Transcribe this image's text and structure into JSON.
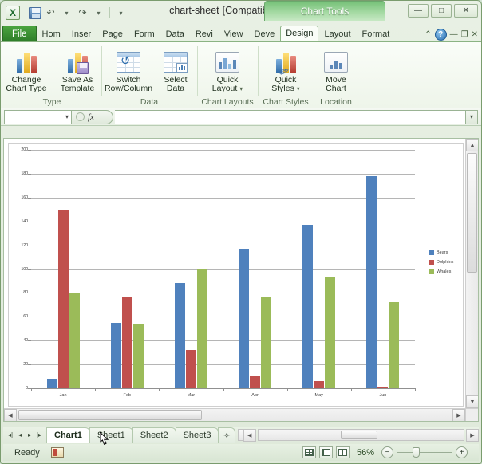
{
  "window": {
    "document_title": "chart-sheet",
    "compat_mode": "[Compatibility Mode]",
    "contextual_tab_title": "Chart Tools",
    "app_icon": "X",
    "minimize": "—",
    "maximize": "□",
    "close": "✕"
  },
  "quick_access": {
    "save": "save-icon",
    "undo": "↶",
    "undo_caret": "▾",
    "redo": "↷",
    "redo_caret": "▾",
    "customize": "▾"
  },
  "ribbon": {
    "tabs": [
      {
        "label": "File",
        "type": "file"
      },
      {
        "label": "Hom",
        "type": "normal"
      },
      {
        "label": "Inser",
        "type": "normal"
      },
      {
        "label": "Page",
        "type": "normal"
      },
      {
        "label": "Form",
        "type": "normal"
      },
      {
        "label": "Data",
        "type": "normal"
      },
      {
        "label": "Revi",
        "type": "normal"
      },
      {
        "label": "View",
        "type": "normal"
      },
      {
        "label": "Deve",
        "type": "normal"
      },
      {
        "label": "Design",
        "type": "active"
      },
      {
        "label": "Layout",
        "type": "normal"
      },
      {
        "label": "Format",
        "type": "normal"
      }
    ],
    "help_label": "?",
    "minimize_ribbon": "⌃",
    "win_restore_down": "—",
    "win_restore": "❐",
    "win_close_doc": "✕",
    "groups": [
      {
        "name": "Type",
        "buttons": [
          {
            "label_line1": "Change",
            "label_line2": "Chart Type",
            "icon": "change-chart-type-icon",
            "caret": false
          },
          {
            "label_line1": "Save As",
            "label_line2": "Template",
            "icon": "save-as-template-icon",
            "caret": false
          }
        ]
      },
      {
        "name": "Data",
        "buttons": [
          {
            "label_line1": "Switch",
            "label_line2": "Row/Column",
            "icon": "switch-row-column-icon",
            "caret": false
          },
          {
            "label_line1": "Select",
            "label_line2": "Data",
            "icon": "select-data-icon",
            "caret": false
          }
        ]
      },
      {
        "name": "Chart Layouts",
        "buttons": [
          {
            "label_line1": "Quick",
            "label_line2": "Layout",
            "icon": "quick-layout-icon",
            "caret": true
          }
        ]
      },
      {
        "name": "Chart Styles",
        "buttons": [
          {
            "label_line1": "Quick",
            "label_line2": "Styles",
            "icon": "quick-styles-icon",
            "caret": true
          }
        ]
      },
      {
        "name": "Location",
        "buttons": [
          {
            "label_line1": "Move",
            "label_line2": "Chart",
            "icon": "move-chart-icon",
            "caret": false
          }
        ]
      }
    ]
  },
  "formula_bar": {
    "name_box_value": "",
    "name_box_caret": "▾",
    "fx_label": "fx",
    "formula_value": "",
    "expand_caret": "▾"
  },
  "chart_data": {
    "type": "bar",
    "title": "",
    "xlabel": "",
    "ylabel": "",
    "categories": [
      "Jan",
      "Feb",
      "Mar",
      "Apr",
      "May",
      "Jun"
    ],
    "series": [
      {
        "name": "Bears",
        "color": "#4F81BD",
        "values": [
          8,
          55,
          88,
          117,
          137,
          178
        ]
      },
      {
        "name": "Dolphins",
        "color": "#C0504D",
        "values": [
          150,
          77,
          32,
          11,
          6,
          1
        ]
      },
      {
        "name": "Whales",
        "color": "#9BBB59",
        "values": [
          80,
          54,
          100,
          76,
          93,
          72
        ]
      }
    ],
    "ylim": [
      0,
      200
    ],
    "ytick_step": 20,
    "yticks": [
      0,
      20,
      40,
      60,
      80,
      100,
      120,
      140,
      160,
      180,
      200
    ],
    "grid": true,
    "legend_position": "right"
  },
  "sheet_tabs": {
    "nav_first": "❘◀",
    "nav_prev": "◀",
    "nav_next": "▶",
    "nav_last": "▶❘",
    "tabs": [
      {
        "label": "Chart1",
        "active": true
      },
      {
        "label": "Sheet1",
        "active": false
      },
      {
        "label": "Sheet2",
        "active": false
      },
      {
        "label": "Sheet3",
        "active": false
      }
    ],
    "insert_sheet": "insert-worksheet-icon"
  },
  "status_bar": {
    "status_text": "Ready",
    "macro_record_icon": "record-macro-icon",
    "view_normal": "normal-view-icon",
    "view_page_layout": "page-layout-view-icon",
    "view_page_break": "page-break-preview-icon",
    "zoom_level": "56%",
    "zoom_out": "−",
    "zoom_in": "+"
  },
  "colors": {
    "series_blue": "#4F81BD",
    "series_red": "#C0504D",
    "series_green": "#9BBB59",
    "ribbon_green": "#2e7d29",
    "chart_tools_green": "#a8dba6"
  }
}
